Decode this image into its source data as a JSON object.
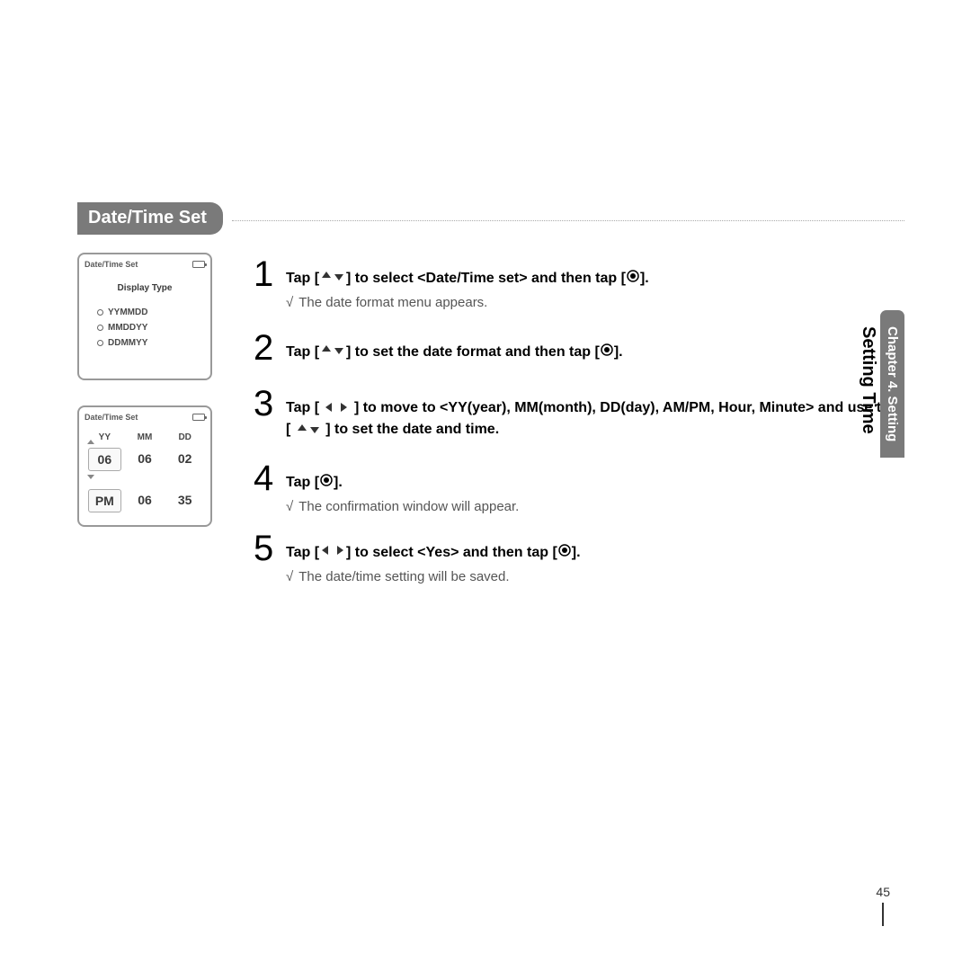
{
  "section_title": "Date/Time Set",
  "screenshot1": {
    "header": "Date/Time Set",
    "sub": "Display Type",
    "options": [
      "YYMMDD",
      "MMDDYY",
      "DDMMYY"
    ]
  },
  "screenshot2": {
    "header": "Date/Time Set",
    "cols": [
      "YY",
      "MM",
      "DD"
    ],
    "row1": [
      "06",
      "06",
      "02"
    ],
    "row2": [
      "PM",
      "06",
      "35"
    ]
  },
  "steps": {
    "s1": {
      "num": "1",
      "pre": "Tap [",
      "mid": "] to select <Date/Time set> and then tap [",
      "post": "].",
      "note": "The date format menu appears."
    },
    "s2": {
      "num": "2",
      "pre": "Tap [",
      "mid": "] to set the date format and then tap [",
      "post": "]."
    },
    "s3": {
      "num": "3",
      "pre": "Tap [",
      "mid": "] to move to <YY(year), MM(month), DD(day), AM/PM, Hour, Minute> and use the [",
      "post": "] to set the date and time."
    },
    "s4": {
      "num": "4",
      "pre": "Tap [",
      "post": "].",
      "note": "The confirmation window will appear."
    },
    "s5": {
      "num": "5",
      "pre": "Tap [",
      "mid": "] to select <Yes> and then tap [",
      "post": "].",
      "note": "The date/time setting will be saved."
    }
  },
  "side": {
    "chapter": "Chapter 4. Setting",
    "title": "Setting Time"
  },
  "page_number": "45"
}
